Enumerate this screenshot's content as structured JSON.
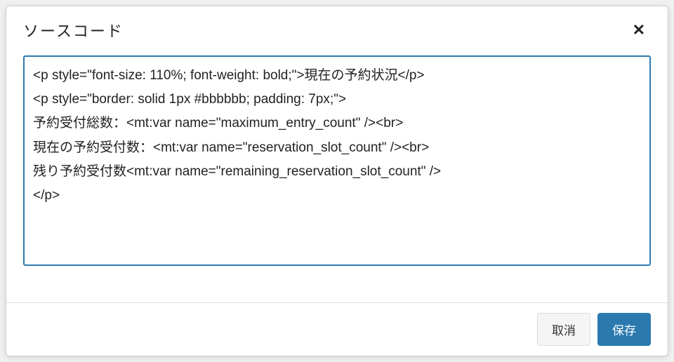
{
  "dialog": {
    "title": "ソースコード",
    "close_label": "✕",
    "code_value": "<p style=\"font-size: 110%; font-weight: bold;\">現在の予約状況</p>\n<p style=\"border: solid 1px #bbbbbb; padding: 7px;\">\n予約受付総数：<mt:var name=\"maximum_entry_count\" /><br>\n現在の予約受付数：<mt:var name=\"reservation_slot_count\" /><br>\n残り予約受付数<mt:var name=\"remaining_reservation_slot_count\" />\n</p>",
    "cancel_label": "取消",
    "save_label": "保存"
  }
}
